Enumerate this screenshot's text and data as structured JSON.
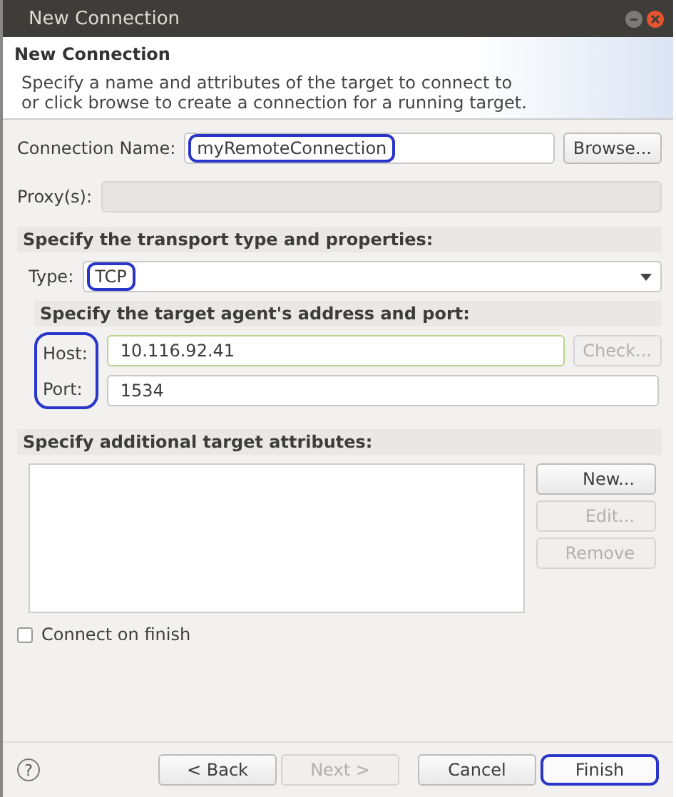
{
  "window": {
    "title": "New Connection"
  },
  "header": {
    "title": "New Connection",
    "description": "Specify a name and attributes of the target to connect to\nor click browse to create a connection for a running target."
  },
  "connection_name": {
    "label": "Connection Name:",
    "value": "myRemoteConnection",
    "highlighted": true,
    "button": {
      "label": "Browse...",
      "disabled": false
    }
  },
  "proxy": {
    "label": "Proxy(s):",
    "disabled": true
  },
  "transport": {
    "heading": "Specify the transport type and properties:",
    "type_label": "Type:",
    "type_value": "TCP",
    "type_highlighted": true,
    "address": {
      "heading": "Specify the target agent's address and port:",
      "highlighted": true,
      "host": {
        "label": "Host:",
        "value": "10.116.92.41",
        "focused": true
      },
      "check_button": {
        "label": "Check...",
        "disabled": true
      },
      "port": {
        "label": "Port:",
        "value": "1534",
        "focused": false
      }
    }
  },
  "attributes": {
    "heading": "Specify additional target attributes:",
    "buttons": [
      {
        "label": "New...",
        "disabled": false
      },
      {
        "label": "Edit...",
        "disabled": true
      },
      {
        "label": "Remove",
        "disabled": true
      }
    ]
  },
  "connect_on_finish": {
    "label": "Connect on finish",
    "checked": false
  },
  "footer": {
    "help": "?",
    "buttons": [
      {
        "label": "< Back",
        "disabled": false,
        "highlighted": false
      },
      {
        "label": "Next >",
        "disabled": true,
        "highlighted": false
      },
      {
        "label": "Cancel",
        "disabled": false,
        "highlighted": false
      },
      {
        "label": "Finish",
        "disabled": false,
        "highlighted": true
      }
    ]
  }
}
